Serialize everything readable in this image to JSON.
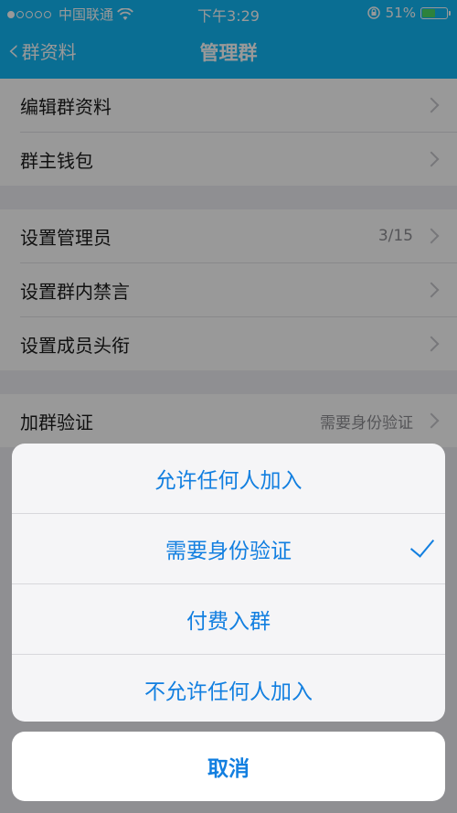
{
  "status": {
    "carrier": "中国联通",
    "time": "下午3:29",
    "battery": "51%"
  },
  "nav": {
    "back_label": "群资料",
    "title": "管理群"
  },
  "groups": [
    {
      "rows": [
        {
          "label": "编辑群资料"
        },
        {
          "label": "群主钱包"
        }
      ]
    },
    {
      "rows": [
        {
          "label": "设置管理员",
          "value": "3/15"
        },
        {
          "label": "设置群内禁言"
        },
        {
          "label": "设置成员头衔"
        }
      ]
    },
    {
      "rows": [
        {
          "label": "加群验证",
          "value": "需要身份验证"
        }
      ]
    }
  ],
  "sheet": {
    "options": [
      {
        "label": "允许任何人加入"
      },
      {
        "label": "需要身份验证",
        "selected": true
      },
      {
        "label": "付费入群"
      },
      {
        "label": "不允许任何人加入"
      }
    ],
    "cancel_label": "取消"
  },
  "colors": {
    "nav": "#12b7f5",
    "accent": "#127fe0",
    "battery": "#4cd964"
  }
}
